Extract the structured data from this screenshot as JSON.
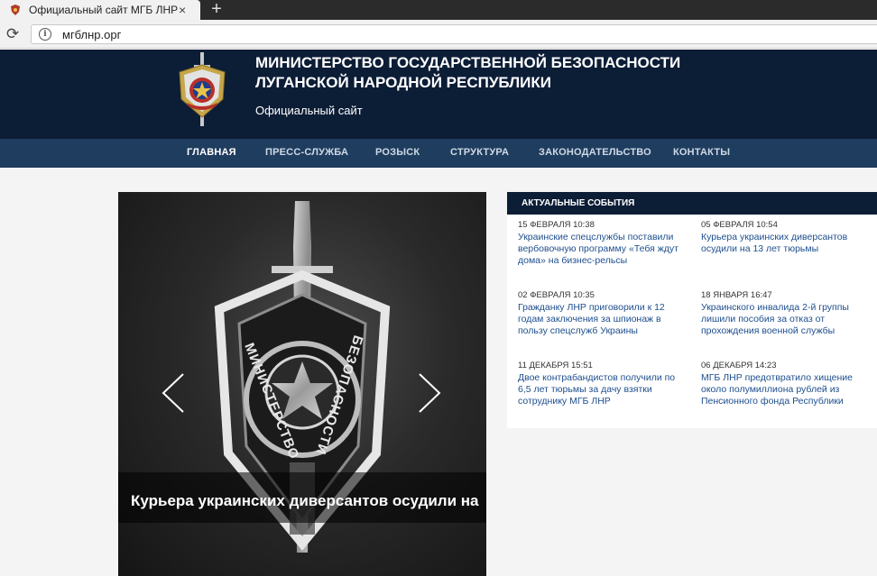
{
  "browser": {
    "tab_title": "Официальный сайт МГБ ЛНР",
    "tab_close": "×",
    "new_tab": "+",
    "reload": "⟳",
    "info": "i",
    "url": "мгблнр.орг"
  },
  "header": {
    "title": "МИНИСТЕРСТВО ГОСУДАРСТВЕННОЙ БЕЗОПАСНОСТИ ЛУГАНСКОЙ НАРОДНОЙ РЕСПУБЛИКИ",
    "subtitle": "Официальный сайт"
  },
  "nav": {
    "items": [
      {
        "label": "ГЛАВНАЯ"
      },
      {
        "label": "ПРЕСС-СЛУЖБА"
      },
      {
        "label": "РОЗЫСК"
      },
      {
        "label": "СТРУКТУРА"
      },
      {
        "label": "ЗАКОНОДАТЕЛЬСТВО"
      },
      {
        "label": "КОНТАКТЫ"
      }
    ]
  },
  "slider": {
    "caption": "Курьера украинских диверсантов осудили на",
    "emblem_left_text": "МИНИСТЕРСТВО",
    "emblem_right_text": "БЕЗОПАСНОСТИ"
  },
  "news": {
    "heading": "АКТУАЛЬНЫЕ СОБЫТИЯ",
    "items": [
      {
        "date": "15 ФЕВРАЛЯ 10:38",
        "title": "Украинские спецслужбы поставили вербовочную программу «Тебя ждут дома» на бизнес-рельсы"
      },
      {
        "date": "05 ФЕВРАЛЯ 10:54",
        "title": "Курьера украинских диверсантов осудили на 13 лет тюрьмы"
      },
      {
        "date": "02 ФЕВРАЛЯ 10:35",
        "title": "Гражданку ЛНР приговорили к 12 годам заключения за шпионаж в пользу спецслужб Украины"
      },
      {
        "date": "18 ЯНВАРЯ 16:47",
        "title": "Украинского инвалида 2-й группы лишили пособия за отказ от прохождения военной службы"
      },
      {
        "date": "11 ДЕКАБРЯ 15:51",
        "title": "Двое контрабандистов получили по 6,5 лет тюрьмы за дачу взятки сотруднику МГБ ЛНР"
      },
      {
        "date": "06 ДЕКАБРЯ 14:23",
        "title": "МГБ ЛНР предотвратило хищение около полумиллиона рублей из Пенсионного фонда Республики"
      }
    ]
  },
  "colors": {
    "header_bg": "#0c1d36",
    "nav_bg": "#1f3d5e",
    "link": "#1e4f8e"
  }
}
